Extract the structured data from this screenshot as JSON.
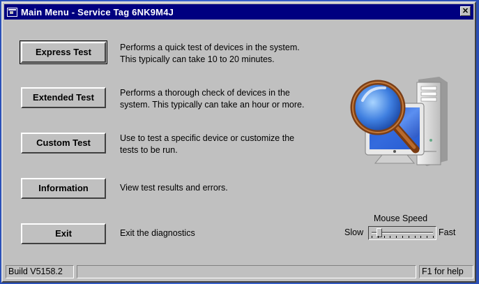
{
  "window": {
    "title": "Main Menu - Service Tag 6NK9M4J",
    "close_label": "✕"
  },
  "menu": [
    {
      "button": "Express Test",
      "description": [
        "Performs a quick test of devices in the system.",
        "This typically can take 10 to 20 minutes."
      ]
    },
    {
      "button": "Extended Test",
      "description": [
        "Performs a thorough check of devices in the",
        "system.  This typically can take an hour or more."
      ]
    },
    {
      "button": "Custom Test",
      "description": [
        "Use to test a specific device or customize the",
        "tests to be run."
      ]
    },
    {
      "button": "Information",
      "description": [
        "View test results and errors."
      ]
    },
    {
      "button": "Exit",
      "description": [
        "Exit the diagnostics"
      ]
    }
  ],
  "mouse_speed": {
    "label": "Mouse Speed",
    "slow_label": "Slow",
    "fast_label": "Fast",
    "value_fraction": 0.12,
    "ticks": 11
  },
  "status": {
    "build": "Build  V5158.2",
    "middle": "",
    "help": "F1 for help"
  },
  "icons": {
    "graphic": "magnifier-over-computer-icon"
  },
  "colors": {
    "titlebar": "#000080",
    "window_bg": "#c0c0c0",
    "desktop": "#2a50b8"
  }
}
